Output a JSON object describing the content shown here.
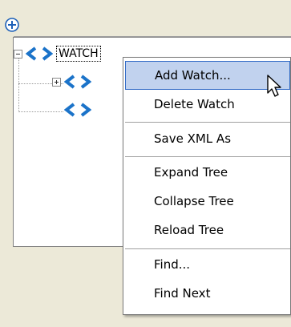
{
  "toolbar": {
    "add_icon": "plus-circle-icon",
    "add_icon_color": "#1c5fb8"
  },
  "tree": {
    "root": {
      "label": "WATCH",
      "expander": "minus",
      "icon": "xml-tag-icon"
    },
    "children": [
      {
        "expander": "plus",
        "icon": "xml-tag-icon"
      },
      {
        "expander": "none",
        "icon": "xml-tag-icon"
      }
    ],
    "icon_color": "#1b73c9"
  },
  "context_menu": {
    "groups": [
      [
        {
          "label": "Add Watch...",
          "highlighted": true
        },
        {
          "label": "Delete Watch",
          "highlighted": false
        }
      ],
      [
        {
          "label": "Save XML As",
          "highlighted": false
        }
      ],
      [
        {
          "label": "Expand Tree",
          "highlighted": false
        },
        {
          "label": "Collapse Tree",
          "highlighted": false
        },
        {
          "label": "Reload Tree",
          "highlighted": false
        }
      ],
      [
        {
          "label": "Find...",
          "highlighted": false
        },
        {
          "label": "Find Next",
          "highlighted": false
        }
      ]
    ],
    "highlight_color": "#c1d2ee"
  },
  "cursor": {
    "icon": "arrow-cursor-icon"
  }
}
